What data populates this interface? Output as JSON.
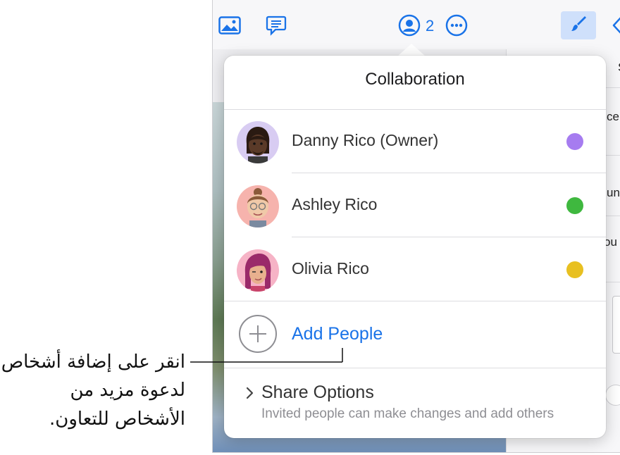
{
  "toolbar": {
    "collaborator_count": "2",
    "icons": [
      "photo-icon",
      "comment-icon",
      "person-circle-icon",
      "ellipsis-icon",
      "paintbrush-icon",
      "chevron-left-icon"
    ]
  },
  "sidepanel_fragments": [
    "S",
    "ce",
    "un",
    "ou"
  ],
  "popover": {
    "title": "Collaboration",
    "people": [
      {
        "name": "Danny Rico (Owner)",
        "color": "#a67cf0"
      },
      {
        "name": "Ashley Rico",
        "color": "#3fb83f"
      },
      {
        "name": "Olivia Rico",
        "color": "#e8c021"
      }
    ],
    "add_people_label": "Add People",
    "share_options_label": "Share Options",
    "share_options_sub": "Invited people can make changes and add others"
  },
  "callout": {
    "lines": [
      "انقر على إضافة أشخاص",
      "لدعوة مزيد من",
      "الأشخاص للتعاون."
    ]
  },
  "colors": {
    "accent": "#1a73e8"
  }
}
